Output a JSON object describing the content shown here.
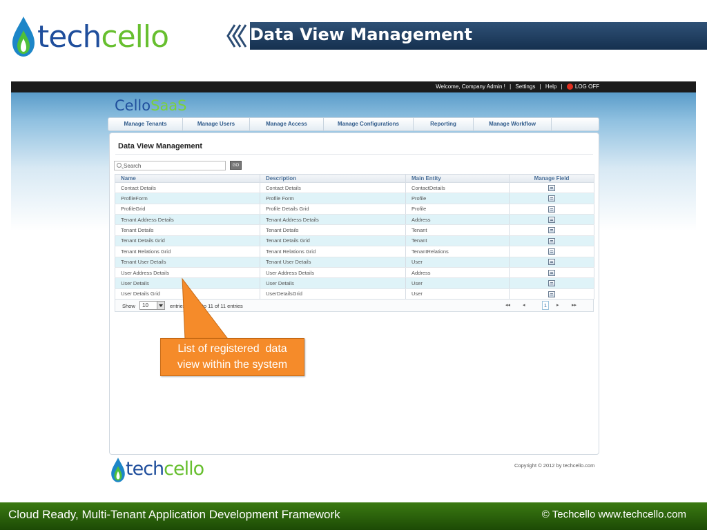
{
  "slide": {
    "logo": {
      "brand_part1": "tech",
      "brand_part2": "cello"
    },
    "title": "Data View Management",
    "tagline": "Cloud Ready, Multi-Tenant Application Development Framework",
    "copyright": "© Techcello www.techcello.com",
    "callout": {
      "line1": "List of registered  data",
      "line2": "view within the system"
    }
  },
  "app": {
    "topbar": {
      "welcome": "Welcome, Company Admin !",
      "sep1": "|",
      "settings": "Settings",
      "sep2": "|",
      "help": "Help",
      "sep3": "|",
      "logoff": "LOG OFF"
    },
    "logo": {
      "part1": "Cello",
      "part2": "SaaS"
    },
    "nav": [
      "Manage Tenants",
      "Manage Users",
      "Manage Access",
      "Manage Configurations",
      "Reporting",
      "Manage Workflow"
    ],
    "panel_title": "Data View Management",
    "search": {
      "placeholder": "Search",
      "go_label": "GO"
    },
    "grid": {
      "columns": [
        "Name",
        "Description",
        "Main Entity",
        "Manage Field"
      ],
      "rows": [
        [
          "Contact Details",
          "Contact Details",
          "ContactDetails"
        ],
        [
          "ProfileForm",
          "Profile Form",
          "Profile"
        ],
        [
          "ProfileGrid",
          "Profile Details Grid",
          "Profile"
        ],
        [
          "Tenant Address Details",
          "Tenant Address Details",
          "Address"
        ],
        [
          "Tenant Details",
          "Tenant Details",
          "Tenant"
        ],
        [
          "Tenant Details Grid",
          "Tenant Details Grid",
          "Tenant"
        ],
        [
          "Tenant Relations Grid",
          "Tenant Relations Grid",
          "TenantRelations"
        ],
        [
          "Tenant User Details",
          "Tenant User Details",
          "User"
        ],
        [
          "User Address Details",
          "User Address Details",
          "Address"
        ],
        [
          "User Details",
          "User Details",
          "User"
        ],
        [
          "User Details Grid",
          "UserDetailsGrid",
          "User"
        ]
      ],
      "row_icon": "document-edit-icon"
    },
    "footer": {
      "show_label": "Show",
      "page_size": "10",
      "entries_label": "entries",
      "info": "wing 1 to 11 of 11 entries",
      "first": "◂◂",
      "prev": "◂",
      "current_page": "1",
      "next": "▸",
      "last": "▸▸"
    },
    "bottom_logo": {
      "part1": "tech",
      "part2": "cello"
    },
    "copyright": "Copyright © 2012 by techcello.com"
  },
  "colors": {
    "brand_blue": "#1f4e9c",
    "brand_green": "#7bd13a",
    "callout": "#f58b2a",
    "title_bar": "#1f3e63",
    "bottom_bar": "#2d6410"
  }
}
